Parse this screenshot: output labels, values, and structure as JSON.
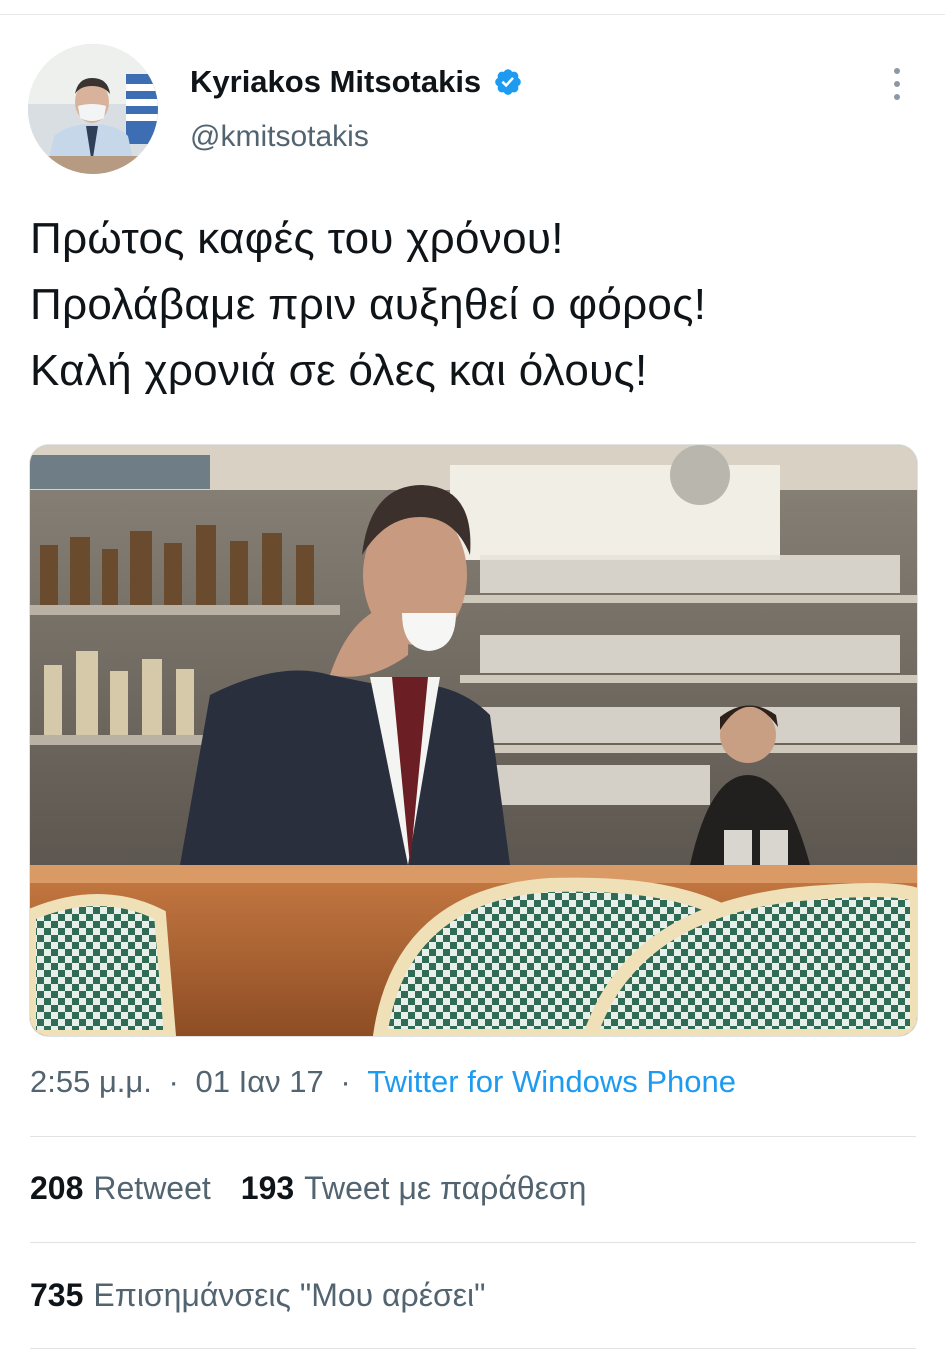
{
  "author": {
    "display_name": "Kyriakos Mitsotakis",
    "handle": "@kmitsotakis",
    "verified_icon": "verified-badge-icon",
    "accent": "#1d9bf0"
  },
  "tweet": {
    "lines": [
      "Πρώτος καφές του χρόνου!",
      "Προλάβαμε πριν αυξηθεί ο φόρος!",
      "Καλή χρονιά σε όλες και όλους!"
    ]
  },
  "meta": {
    "time": "2:55 μ.μ.",
    "separator": "·",
    "date": "01 Ιαν 17",
    "source": "Twitter for Windows Phone"
  },
  "stats": {
    "retweets": {
      "count": "208",
      "label": "Retweet"
    },
    "quotes": {
      "count": "193",
      "label": "Tweet με παράθεση"
    },
    "likes": {
      "count": "735",
      "label": "Επισημάνσεις \"Μου αρέσει\""
    }
  },
  "colors": {
    "text_primary": "#0f1419",
    "text_secondary": "#536471",
    "link": "#1d9bf0",
    "divider": "#dfe3e6"
  }
}
